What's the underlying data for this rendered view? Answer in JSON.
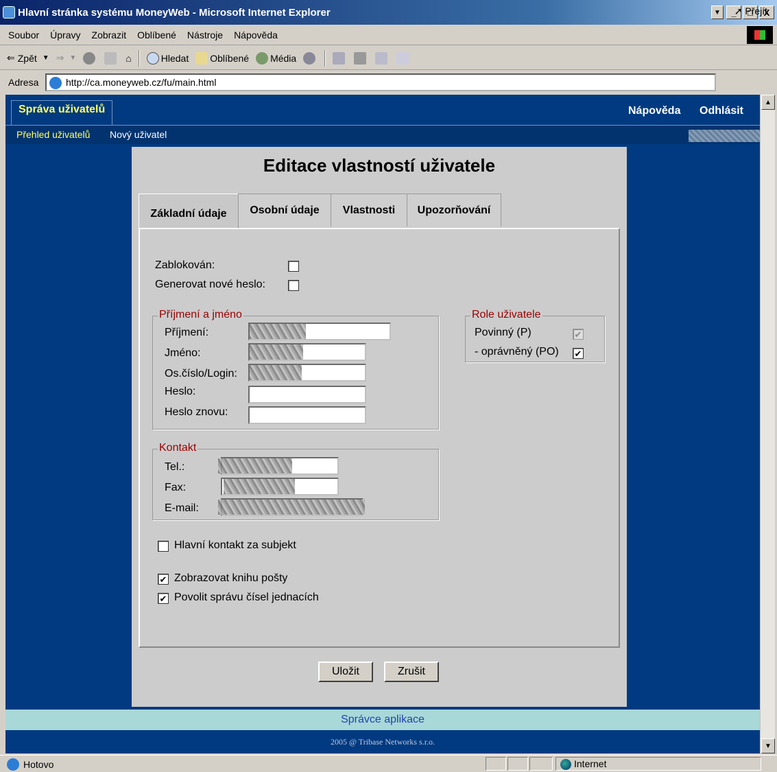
{
  "window": {
    "title": "Hlavní stránka systému MoneyWeb - Microsoft Internet Explorer",
    "minimize": "_",
    "maximize": "□",
    "close": "X"
  },
  "menu": [
    "Soubor",
    "Úpravy",
    "Zobrazit",
    "Oblíbené",
    "Nástroje",
    "Nápověda"
  ],
  "toolbar": {
    "back": "Zpět",
    "search": "Hledat",
    "favorites": "Oblíbené",
    "media": "Média"
  },
  "address": {
    "label": "Adresa",
    "url": "http://ca.moneyweb.cz/fu/main.html",
    "go": "Přejít"
  },
  "app": {
    "tab": "Správa uživatelů",
    "help": "Nápověda",
    "logout": "Odhlásit",
    "subnav": [
      "Přehled uživatelů",
      "Nový uživatel"
    ]
  },
  "form": {
    "title": "Editace vlastností uživatele",
    "tabs": [
      "Základní údaje",
      "Osobní údaje",
      "Vlastnosti",
      "Upozorňování"
    ],
    "blocked_label": "Zablokován:",
    "new_password_label": "Generovat nové heslo:",
    "name_group": {
      "legend": "Příjmení a jméno",
      "surname": "Příjmení:",
      "firstname": "Jméno:",
      "login": "Os.číslo/Login:",
      "password": "Heslo:",
      "password_again": "Heslo znovu:"
    },
    "contact_group": {
      "legend": "Kontakt",
      "phone": "Tel.:",
      "fax": "Fax:",
      "email": "E-mail:"
    },
    "roles": {
      "legend": "Role uživatele",
      "mandatory": "Povinný (P)",
      "authorized": "- oprávněný (PO)"
    },
    "main_contact": "Hlavní kontakt za subjekt",
    "show_mailbook": "Zobrazovat knihu pošty",
    "allow_numbers": "Povolit správu čísel jednacích",
    "save": "Uložit",
    "cancel": "Zrušit",
    "checkbox_mark": "✔"
  },
  "footer": {
    "admin": "Správce aplikace",
    "copyright": "2005 @ Tribase Networks s.r.o."
  },
  "status": {
    "text": "Hotovo",
    "zone": "Internet"
  }
}
